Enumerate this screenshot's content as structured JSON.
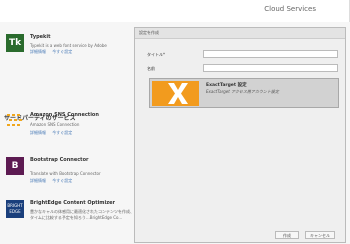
{
  "header": {
    "title": "Cloud Services"
  },
  "items": [
    {
      "icon": "Tk",
      "title": "Typekit",
      "desc": "Typekit is a web font service by Adobe",
      "links": [
        "詳細情報",
        "今すぐ設定"
      ]
    },
    {
      "icon": "aws-icon",
      "title": "Amazon SNS Connection",
      "desc": "Amazon SNS Connection",
      "links": [
        "詳細情報",
        "今すぐ設定"
      ]
    },
    {
      "icon": "B",
      "title": "Bootstrap Connector",
      "desc": "Translate with Bootstrap Connector",
      "links": [
        "詳細情報",
        "今すぐ設定"
      ]
    },
    {
      "icon": "BRIGHT EDGE",
      "title": "BrightEdge Content Optimizer",
      "desc": "豊かなキャルの体感用に最適化されたコンテンツを作成、",
      "desc2": "タイムに比較する予定を知ろう...BrightEdge Co..."
    }
  ],
  "section": "サードパーティのサービス",
  "dialog": {
    "header": "設定を作成",
    "title_label": "タイトル*",
    "name_label": "名前",
    "item_title": "ExactTarget 設定",
    "item_sub": "ExactTarget アクセス用アカウント設定",
    "ok": "作成",
    "cancel": "キャンセル"
  }
}
